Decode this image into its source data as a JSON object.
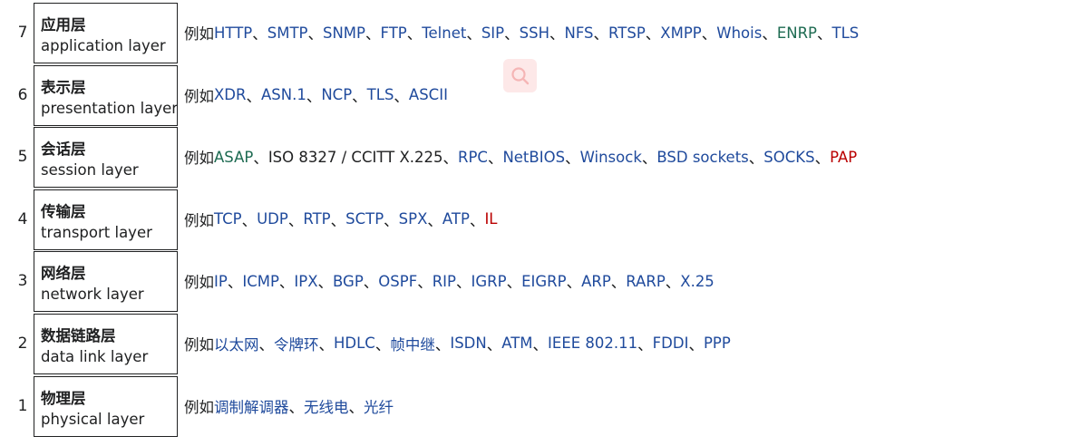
{
  "layers": [
    {
      "num": "7",
      "name_cn": "应用层",
      "name_en": "application layer",
      "prefix": "例如",
      "items": [
        {
          "text": "HTTP",
          "color": "blue"
        },
        {
          "text": "SMTP",
          "color": "blue"
        },
        {
          "text": "SNMP",
          "color": "blue"
        },
        {
          "text": "FTP",
          "color": "blue"
        },
        {
          "text": "Telnet",
          "color": "blue"
        },
        {
          "text": "SIP",
          "color": "blue"
        },
        {
          "text": "SSH",
          "color": "blue"
        },
        {
          "text": "NFS",
          "color": "blue"
        },
        {
          "text": "RTSP",
          "color": "blue"
        },
        {
          "text": "XMPP",
          "color": "blue"
        },
        {
          "text": "Whois",
          "color": "blue"
        },
        {
          "text": "ENRP",
          "color": "green"
        },
        {
          "text": "TLS",
          "color": "blue"
        }
      ]
    },
    {
      "num": "6",
      "name_cn": "表示层",
      "name_en": "presentation layer",
      "prefix": "例如",
      "items": [
        {
          "text": "XDR",
          "color": "blue"
        },
        {
          "text": "ASN.1",
          "color": "blue"
        },
        {
          "text": "NCP",
          "color": "blue"
        },
        {
          "text": "TLS",
          "color": "blue"
        },
        {
          "text": "ASCII",
          "color": "blue"
        }
      ]
    },
    {
      "num": "5",
      "name_cn": "会话层",
      "name_en": "session layer",
      "prefix": "例如",
      "items": [
        {
          "text": "ASAP",
          "color": "green"
        },
        {
          "text": "ISO 8327 / CCITT X.225",
          "color": "plain"
        },
        {
          "text": "RPC",
          "color": "blue"
        },
        {
          "text": "NetBIOS",
          "color": "blue"
        },
        {
          "text": "Winsock",
          "color": "blue"
        },
        {
          "text": "BSD sockets",
          "color": "blue"
        },
        {
          "text": "SOCKS",
          "color": "blue"
        },
        {
          "text": "PAP",
          "color": "red"
        }
      ]
    },
    {
      "num": "4",
      "name_cn": "传输层",
      "name_en": "transport layer",
      "prefix": "例如",
      "items": [
        {
          "text": "TCP",
          "color": "blue"
        },
        {
          "text": "UDP",
          "color": "blue"
        },
        {
          "text": "RTP",
          "color": "blue"
        },
        {
          "text": "SCTP",
          "color": "blue"
        },
        {
          "text": "SPX",
          "color": "blue"
        },
        {
          "text": "ATP",
          "color": "blue"
        },
        {
          "text": "IL",
          "color": "red"
        }
      ]
    },
    {
      "num": "3",
      "name_cn": "网络层",
      "name_en": "network layer",
      "prefix": "例如",
      "items": [
        {
          "text": "IP",
          "color": "blue"
        },
        {
          "text": "ICMP",
          "color": "blue"
        },
        {
          "text": "IPX",
          "color": "blue"
        },
        {
          "text": "BGP",
          "color": "blue"
        },
        {
          "text": "OSPF",
          "color": "blue"
        },
        {
          "text": "RIP",
          "color": "blue"
        },
        {
          "text": "IGRP",
          "color": "blue"
        },
        {
          "text": "EIGRP",
          "color": "blue"
        },
        {
          "text": "ARP",
          "color": "blue"
        },
        {
          "text": "RARP",
          "color": "blue"
        },
        {
          "text": "X.25",
          "color": "blue"
        }
      ]
    },
    {
      "num": "2",
      "name_cn": "数据链路层",
      "name_en": "data link layer",
      "prefix": "例如",
      "items": [
        {
          "text": "以太网",
          "color": "blue"
        },
        {
          "text": "令牌环",
          "color": "blue"
        },
        {
          "text": "HDLC",
          "color": "blue"
        },
        {
          "text": "帧中继",
          "color": "blue"
        },
        {
          "text": "ISDN",
          "color": "blue"
        },
        {
          "text": "ATM",
          "color": "blue"
        },
        {
          "text": "IEEE 802.11",
          "color": "blue"
        },
        {
          "text": "FDDI",
          "color": "blue"
        },
        {
          "text": "PPP",
          "color": "blue"
        }
      ]
    },
    {
      "num": "1",
      "name_cn": "物理层",
      "name_en": "physical layer",
      "prefix": "例如",
      "items": [
        {
          "text": "调制解调器",
          "color": "blue"
        },
        {
          "text": "无线电",
          "color": "blue"
        },
        {
          "text": "光纤",
          "color": "blue"
        }
      ]
    }
  ],
  "separator": "、",
  "colors": {
    "blue": "#1f4a9c",
    "green": "#1e6b52",
    "red": "#ba0000",
    "text": "#202122",
    "search_bg": "#fde8e8",
    "search_icon": "#f5b5b5"
  },
  "search_button_icon": "search-icon"
}
